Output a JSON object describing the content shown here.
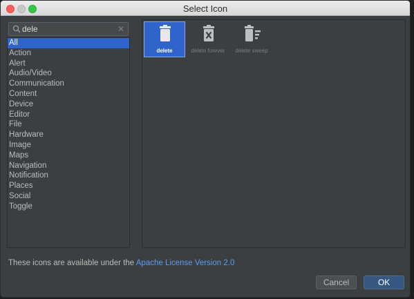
{
  "window": {
    "title": "Select Icon"
  },
  "search": {
    "value": "dele",
    "placeholder": ""
  },
  "categories": [
    "All",
    "Action",
    "Alert",
    "Audio/Video",
    "Communication",
    "Content",
    "Device",
    "Editor",
    "File",
    "Hardware",
    "Image",
    "Maps",
    "Navigation",
    "Notification",
    "Places",
    "Social",
    "Toggle"
  ],
  "selected_category": "All",
  "icons": [
    {
      "label": "delete",
      "icon": "delete-icon",
      "selected": true
    },
    {
      "label": "delete forever",
      "icon": "delete-forever-icon",
      "selected": false
    },
    {
      "label": "delete sweep",
      "icon": "delete-sweep-icon",
      "selected": false
    }
  ],
  "footer": {
    "license_text": "These icons are available under the ",
    "license_link": "Apache License Version 2.0"
  },
  "buttons": {
    "cancel": "Cancel",
    "ok": "OK"
  },
  "colors": {
    "selection": "#2f65ca",
    "link": "#589df6",
    "ok_button": "#365880",
    "panel": "#3c3f41"
  }
}
